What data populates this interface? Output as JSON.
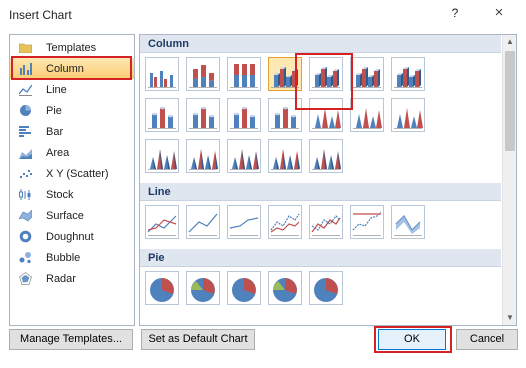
{
  "window": {
    "title": "Insert Chart",
    "help": "?",
    "close": "×"
  },
  "sidebar": {
    "selected": "Column",
    "items": [
      {
        "label": "Templates",
        "icon": "folder-icon"
      },
      {
        "label": "Column",
        "icon": "column-chart-icon"
      },
      {
        "label": "Line",
        "icon": "line-chart-icon"
      },
      {
        "label": "Pie",
        "icon": "pie-chart-icon"
      },
      {
        "label": "Bar",
        "icon": "bar-chart-icon"
      },
      {
        "label": "Area",
        "icon": "area-chart-icon"
      },
      {
        "label": "X Y (Scatter)",
        "icon": "scatter-chart-icon"
      },
      {
        "label": "Stock",
        "icon": "stock-chart-icon"
      },
      {
        "label": "Surface",
        "icon": "surface-chart-icon"
      },
      {
        "label": "Doughnut",
        "icon": "doughnut-chart-icon"
      },
      {
        "label": "Bubble",
        "icon": "bubble-chart-icon"
      },
      {
        "label": "Radar",
        "icon": "radar-chart-icon"
      }
    ]
  },
  "gallery": {
    "sections": [
      {
        "name": "Column",
        "rows": [
          7,
          7,
          5
        ]
      },
      {
        "name": "Line",
        "rows": [
          7
        ]
      },
      {
        "name": "Pie",
        "rows": [
          5
        ]
      }
    ],
    "selected": "3D Clustered Column"
  },
  "buttons": {
    "manage_templates": "Manage Templates...",
    "set_default": "Set as Default Chart",
    "ok": "OK",
    "cancel": "Cancel"
  },
  "colors": {
    "selection": "#fbcd73",
    "highlight": "#d42225",
    "chart_blue": "#4f81bd",
    "chart_red": "#c0504d"
  }
}
